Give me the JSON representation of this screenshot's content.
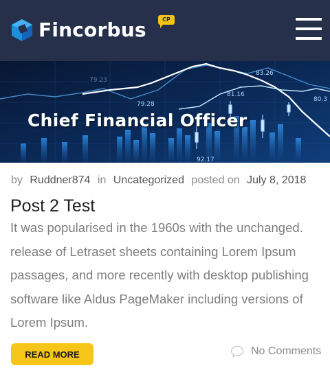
{
  "header": {
    "logo_text": "Fincorbus",
    "logo_badge": "CP",
    "menu_icon": "hamburger-menu-icon",
    "bg_color": "#26304a"
  },
  "banner": {
    "title": "Chief Financial Officer",
    "chart_numbers": [
      "83.26",
      "79.28",
      "81.16",
      "80.3",
      "92.17",
      "79.23"
    ]
  },
  "post": {
    "meta": {
      "by_label": "by",
      "author": "Ruddner874",
      "in_label": "in",
      "category": "Uncategorized",
      "posted_label": "posted on",
      "date": "July 8, 2018"
    },
    "title": "Post 2 Test",
    "excerpt_lines": [
      "It was popularised in the 1960s with the  unchanged.",
      "release of Letraset sheets containing Lorem Ipsum",
      "passages, and more recently with desktop publishing",
      "software like Aldus PageMaker including versions of",
      "Lorem Ipsum."
    ],
    "read_more_label": "READ MORE",
    "comments_label": "No Comments",
    "accent_color": "#f5c518"
  }
}
